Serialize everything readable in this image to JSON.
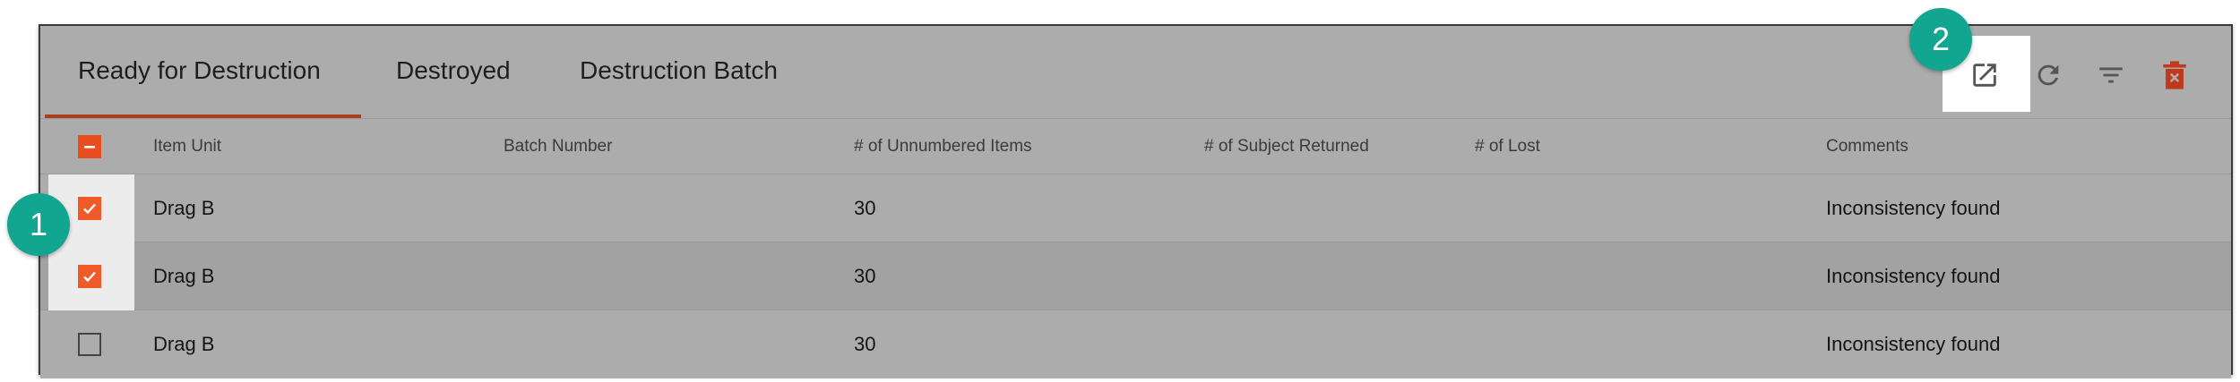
{
  "tabs": [
    {
      "label": "Ready for Destruction",
      "active": true
    },
    {
      "label": "Destroyed",
      "active": false
    },
    {
      "label": "Destruction Batch",
      "active": false
    }
  ],
  "toolbar": {
    "icons": [
      "export-icon",
      "refresh-icon",
      "filter-icon",
      "delete-icon"
    ]
  },
  "table": {
    "columns": [
      "Item Unit",
      "Batch Number",
      "# of Unnumbered Items",
      "# of Subject Returned",
      "# of Lost",
      "Comments"
    ],
    "rows": [
      {
        "checked": true,
        "item_unit": "Drag B",
        "batch_number": "",
        "unnumbered": "30",
        "subject_returned": "",
        "lost": "",
        "comments": "Inconsistency found"
      },
      {
        "checked": true,
        "item_unit": "Drag B",
        "batch_number": "",
        "unnumbered": "30",
        "subject_returned": "",
        "lost": "",
        "comments": "Inconsistency found"
      },
      {
        "checked": false,
        "item_unit": "Drag B",
        "batch_number": "",
        "unnumbered": "30",
        "subject_returned": "",
        "lost": "",
        "comments": "Inconsistency found"
      }
    ]
  },
  "annotations": {
    "badge_1": "1",
    "badge_2": "2"
  },
  "colors": {
    "accent": "#f05a28",
    "tab_underline": "#a8401f",
    "badge": "#12a58f",
    "delete": "#c0391b"
  }
}
